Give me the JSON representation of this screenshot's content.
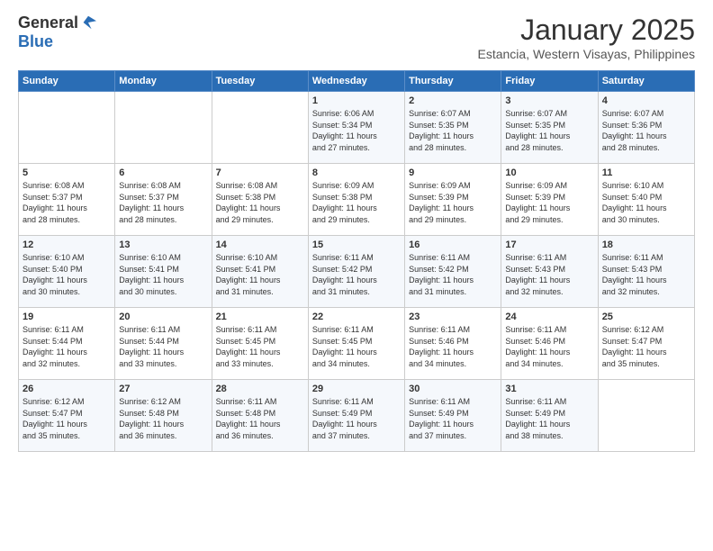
{
  "logo": {
    "general": "General",
    "blue": "Blue"
  },
  "title": "January 2025",
  "subtitle": "Estancia, Western Visayas, Philippines",
  "days_header": [
    "Sunday",
    "Monday",
    "Tuesday",
    "Wednesday",
    "Thursday",
    "Friday",
    "Saturday"
  ],
  "weeks": [
    [
      {
        "day": "",
        "info": ""
      },
      {
        "day": "",
        "info": ""
      },
      {
        "day": "",
        "info": ""
      },
      {
        "day": "1",
        "info": "Sunrise: 6:06 AM\nSunset: 5:34 PM\nDaylight: 11 hours\nand 27 minutes."
      },
      {
        "day": "2",
        "info": "Sunrise: 6:07 AM\nSunset: 5:35 PM\nDaylight: 11 hours\nand 28 minutes."
      },
      {
        "day": "3",
        "info": "Sunrise: 6:07 AM\nSunset: 5:35 PM\nDaylight: 11 hours\nand 28 minutes."
      },
      {
        "day": "4",
        "info": "Sunrise: 6:07 AM\nSunset: 5:36 PM\nDaylight: 11 hours\nand 28 minutes."
      }
    ],
    [
      {
        "day": "5",
        "info": "Sunrise: 6:08 AM\nSunset: 5:37 PM\nDaylight: 11 hours\nand 28 minutes."
      },
      {
        "day": "6",
        "info": "Sunrise: 6:08 AM\nSunset: 5:37 PM\nDaylight: 11 hours\nand 28 minutes."
      },
      {
        "day": "7",
        "info": "Sunrise: 6:08 AM\nSunset: 5:38 PM\nDaylight: 11 hours\nand 29 minutes."
      },
      {
        "day": "8",
        "info": "Sunrise: 6:09 AM\nSunset: 5:38 PM\nDaylight: 11 hours\nand 29 minutes."
      },
      {
        "day": "9",
        "info": "Sunrise: 6:09 AM\nSunset: 5:39 PM\nDaylight: 11 hours\nand 29 minutes."
      },
      {
        "day": "10",
        "info": "Sunrise: 6:09 AM\nSunset: 5:39 PM\nDaylight: 11 hours\nand 29 minutes."
      },
      {
        "day": "11",
        "info": "Sunrise: 6:10 AM\nSunset: 5:40 PM\nDaylight: 11 hours\nand 30 minutes."
      }
    ],
    [
      {
        "day": "12",
        "info": "Sunrise: 6:10 AM\nSunset: 5:40 PM\nDaylight: 11 hours\nand 30 minutes."
      },
      {
        "day": "13",
        "info": "Sunrise: 6:10 AM\nSunset: 5:41 PM\nDaylight: 11 hours\nand 30 minutes."
      },
      {
        "day": "14",
        "info": "Sunrise: 6:10 AM\nSunset: 5:41 PM\nDaylight: 11 hours\nand 31 minutes."
      },
      {
        "day": "15",
        "info": "Sunrise: 6:11 AM\nSunset: 5:42 PM\nDaylight: 11 hours\nand 31 minutes."
      },
      {
        "day": "16",
        "info": "Sunrise: 6:11 AM\nSunset: 5:42 PM\nDaylight: 11 hours\nand 31 minutes."
      },
      {
        "day": "17",
        "info": "Sunrise: 6:11 AM\nSunset: 5:43 PM\nDaylight: 11 hours\nand 32 minutes."
      },
      {
        "day": "18",
        "info": "Sunrise: 6:11 AM\nSunset: 5:43 PM\nDaylight: 11 hours\nand 32 minutes."
      }
    ],
    [
      {
        "day": "19",
        "info": "Sunrise: 6:11 AM\nSunset: 5:44 PM\nDaylight: 11 hours\nand 32 minutes."
      },
      {
        "day": "20",
        "info": "Sunrise: 6:11 AM\nSunset: 5:44 PM\nDaylight: 11 hours\nand 33 minutes."
      },
      {
        "day": "21",
        "info": "Sunrise: 6:11 AM\nSunset: 5:45 PM\nDaylight: 11 hours\nand 33 minutes."
      },
      {
        "day": "22",
        "info": "Sunrise: 6:11 AM\nSunset: 5:45 PM\nDaylight: 11 hours\nand 34 minutes."
      },
      {
        "day": "23",
        "info": "Sunrise: 6:11 AM\nSunset: 5:46 PM\nDaylight: 11 hours\nand 34 minutes."
      },
      {
        "day": "24",
        "info": "Sunrise: 6:11 AM\nSunset: 5:46 PM\nDaylight: 11 hours\nand 34 minutes."
      },
      {
        "day": "25",
        "info": "Sunrise: 6:12 AM\nSunset: 5:47 PM\nDaylight: 11 hours\nand 35 minutes."
      }
    ],
    [
      {
        "day": "26",
        "info": "Sunrise: 6:12 AM\nSunset: 5:47 PM\nDaylight: 11 hours\nand 35 minutes."
      },
      {
        "day": "27",
        "info": "Sunrise: 6:12 AM\nSunset: 5:48 PM\nDaylight: 11 hours\nand 36 minutes."
      },
      {
        "day": "28",
        "info": "Sunrise: 6:11 AM\nSunset: 5:48 PM\nDaylight: 11 hours\nand 36 minutes."
      },
      {
        "day": "29",
        "info": "Sunrise: 6:11 AM\nSunset: 5:49 PM\nDaylight: 11 hours\nand 37 minutes."
      },
      {
        "day": "30",
        "info": "Sunrise: 6:11 AM\nSunset: 5:49 PM\nDaylight: 11 hours\nand 37 minutes."
      },
      {
        "day": "31",
        "info": "Sunrise: 6:11 AM\nSunset: 5:49 PM\nDaylight: 11 hours\nand 38 minutes."
      },
      {
        "day": "",
        "info": ""
      }
    ]
  ]
}
